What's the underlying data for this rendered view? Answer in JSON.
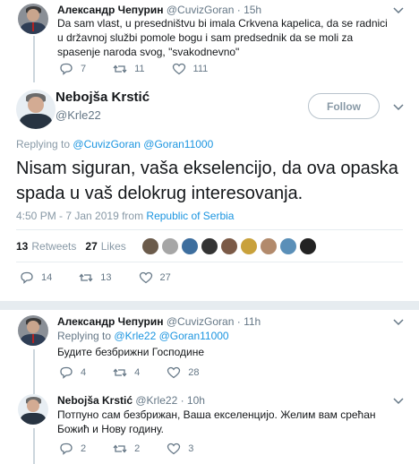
{
  "tweet1": {
    "name": "Александр Чепурин",
    "handle": "@CuvizGoran",
    "time": "· 15h",
    "text": "Da sam vlast, u presedništvu bi imala Crkvena kapelica, da se radnici u državnoj službi pomole bogu i sam predsednik da se moli za spasenje naroda svog, \"svakodnevno\"",
    "replies": "7",
    "retweets": "11",
    "likes": "111"
  },
  "main": {
    "name": "Nebojša Krstić",
    "handle": "@Krle22",
    "follow_label": "Follow",
    "replying_prefix": "Replying to",
    "replying_users": "@CuvizGoran @Goran11000",
    "text": "Nisam siguran, vaša ekselencijo, da ova opaska spada u vaš delokrug interesovanja.",
    "time_date": "4:50 PM - 7 Jan 2019 from",
    "location": "Republic of Serbia",
    "retweets_count": "13",
    "retweets_label": "Retweets",
    "likes_count": "27",
    "likes_label": "Likes",
    "replies": "14",
    "retweets": "13",
    "likes": "27",
    "liker_colors": [
      "#6b5b4b",
      "#a6a6a6",
      "#3d6e9e",
      "#333333",
      "#7b5a47",
      "#c9a13b",
      "#b28a6c",
      "#5a8fb8",
      "#222222"
    ]
  },
  "reply1": {
    "name": "Александр Чепурин",
    "handle": "@CuvizGoran",
    "time": "· 11h",
    "replying_prefix": "Replying to",
    "replying_users": "@Krle22 @Goran11000",
    "text": "Будите безбрижни Господине",
    "replies": "4",
    "retweets": "4",
    "likes": "28"
  },
  "reply2": {
    "name": "Nebojša Krstić",
    "handle": "@Krle22",
    "time": "· 10h",
    "text": "Потпуно сам безбрижан, Ваша екселенцијо. Желим вам срећан Божић и Нову годину.",
    "replies": "2",
    "retweets": "2",
    "likes": "3"
  }
}
